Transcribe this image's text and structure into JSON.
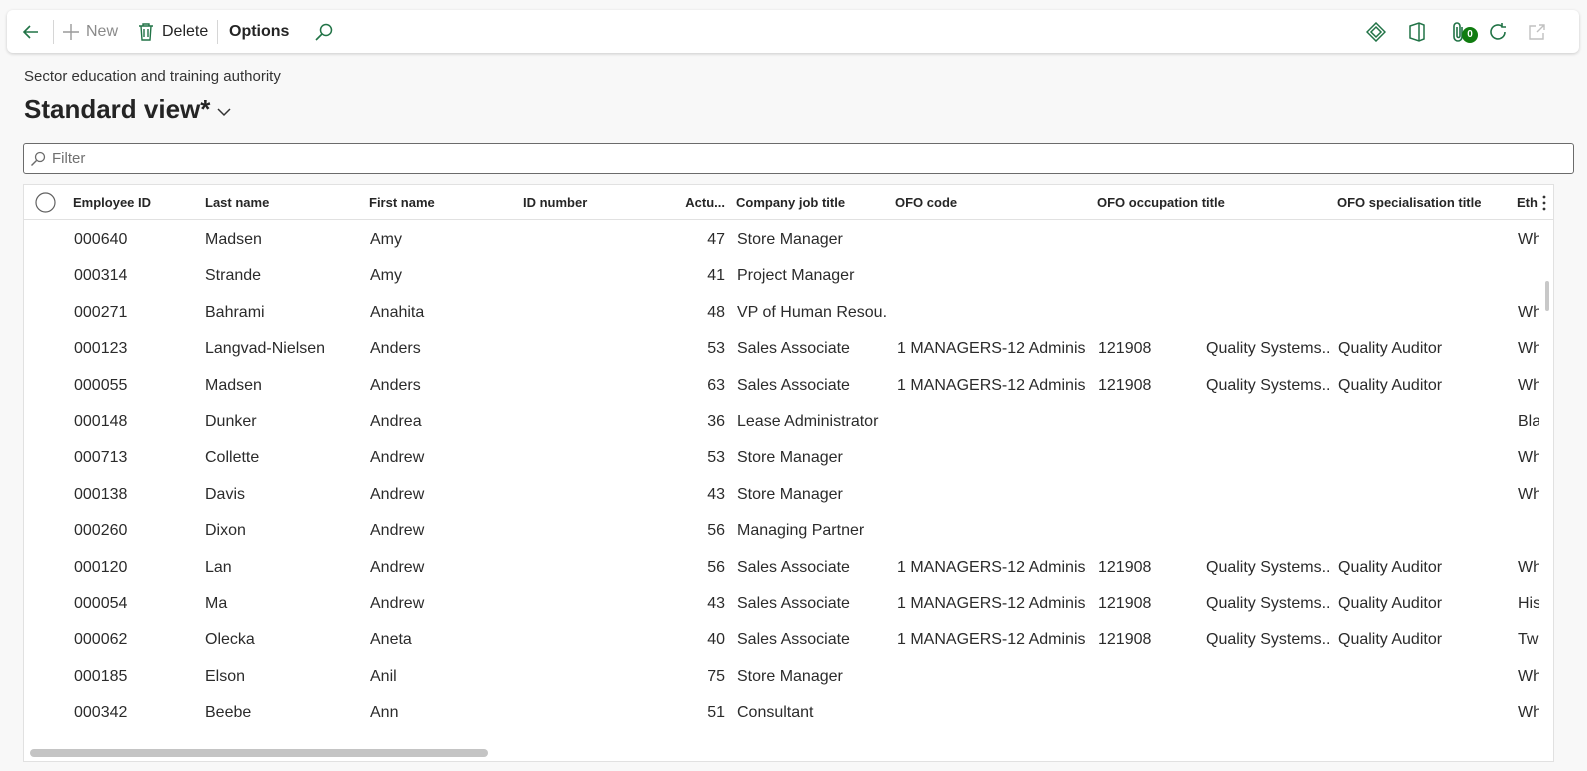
{
  "toolbar": {
    "new_label": "New",
    "delete_label": "Delete",
    "options_label": "Options",
    "attachments_count": "0"
  },
  "page": {
    "caption": "Sector education and training authority",
    "view_name": "Standard view",
    "view_modified": " *"
  },
  "filter": {
    "placeholder": "Filter",
    "value": ""
  },
  "columns": [
    "Employee ID",
    "Last name",
    "First name",
    "ID number",
    "Actu...",
    "Company job title",
    "OFO code",
    "OFO occupation title",
    "OFO specialisation title",
    "Eth"
  ],
  "rows": [
    [
      "000640",
      "Madsen",
      "Amy",
      "",
      "47",
      "Store Manager",
      "",
      "",
      "",
      "",
      "Wh"
    ],
    [
      "000314",
      "Strande",
      "Amy",
      "",
      "41",
      "Project Manager",
      "",
      "",
      "",
      "",
      ""
    ],
    [
      "000271",
      "Bahrami",
      "Anahita",
      "",
      "48",
      "VP of Human Resou...",
      "",
      "",
      "",
      "",
      "Wh"
    ],
    [
      "000123",
      "Langvad-Nielsen",
      "Anders",
      "",
      "53",
      "Sales Associate",
      "1 MANAGERS-12 Adminis...",
      "121908",
      "Quality Systems...",
      "Quality Auditor",
      "Wh"
    ],
    [
      "000055",
      "Madsen",
      "Anders",
      "",
      "63",
      "Sales Associate",
      "1 MANAGERS-12 Adminis...",
      "121908",
      "Quality Systems...",
      "Quality Auditor",
      "Wh"
    ],
    [
      "000148",
      "Dunker",
      "Andrea",
      "",
      "36",
      "Lease Administrator",
      "",
      "",
      "",
      "",
      "Bla"
    ],
    [
      "000713",
      "Collette",
      "Andrew",
      "",
      "53",
      "Store Manager",
      "",
      "",
      "",
      "",
      "Wh"
    ],
    [
      "000138",
      "Davis",
      "Andrew",
      "",
      "43",
      "Store Manager",
      "",
      "",
      "",
      "",
      "Wh"
    ],
    [
      "000260",
      "Dixon",
      "Andrew",
      "",
      "56",
      "Managing Partner",
      "",
      "",
      "",
      "",
      ""
    ],
    [
      "000120",
      "Lan",
      "Andrew",
      "",
      "56",
      "Sales Associate",
      "1 MANAGERS-12 Adminis...",
      "121908",
      "Quality Systems...",
      "Quality Auditor",
      "Wh"
    ],
    [
      "000054",
      "Ma",
      "Andrew",
      "",
      "43",
      "Sales Associate",
      "1 MANAGERS-12 Adminis...",
      "121908",
      "Quality Systems...",
      "Quality Auditor",
      "His"
    ],
    [
      "000062",
      "Olecka",
      "Aneta",
      "",
      "40",
      "Sales Associate",
      "1 MANAGERS-12 Adminis...",
      "121908",
      "Quality Systems...",
      "Quality Auditor",
      "Two"
    ],
    [
      "000185",
      "Elson",
      "Anil",
      "",
      "75",
      "Store Manager",
      "",
      "",
      "",
      "",
      "Wh"
    ],
    [
      "000342",
      "Beebe",
      "Ann",
      "",
      "51",
      "Consultant",
      "",
      "",
      "",
      "",
      "Wh"
    ]
  ],
  "colors": {
    "accent": "#107c10",
    "icon_green": "#217346"
  },
  "icons": [
    "back-arrow-icon",
    "plus-icon",
    "trash-icon",
    "search-icon",
    "diamond-icon",
    "office-icon",
    "paperclip-icon",
    "refresh-icon",
    "open-new-window-icon",
    "chevron-down-icon",
    "more-vertical-icon"
  ]
}
